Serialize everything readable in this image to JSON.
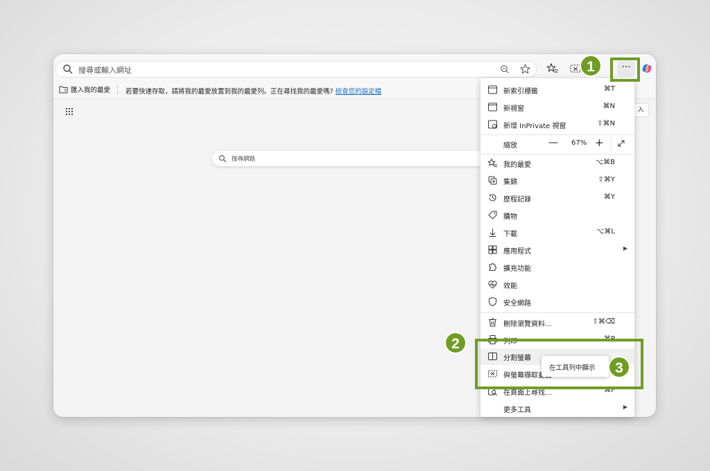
{
  "address_bar": {
    "placeholder": "搜尋或輸入網址"
  },
  "favorites_bar": {
    "import_label": "匯入我的最愛",
    "hint_text": "若要快速存取，請將我的最愛放置到我的最愛列。正在尋找我的最愛嗎?",
    "settings_link": "檢查您的設定檔"
  },
  "new_tab": {
    "search_placeholder": "搜尋網路",
    "signin_label": "入"
  },
  "toolbar": {
    "more_label": "···"
  },
  "menu": {
    "items": [
      {
        "icon": "new-tab-icon",
        "label": "新索引標籤",
        "shortcut": "⌘T"
      },
      {
        "icon": "new-window-icon",
        "label": "新視窗",
        "shortcut": "⌘N"
      },
      {
        "icon": "inprivate-icon",
        "label": "新增 InPrivate 視窗",
        "shortcut": "⇧⌘N"
      },
      {
        "icon": "",
        "label": "縮放",
        "shortcut": ""
      },
      {
        "icon": "favorites-icon",
        "label": "我的最愛",
        "shortcut": "⌥⌘B"
      },
      {
        "icon": "collections-icon",
        "label": "集錦",
        "shortcut": "⇧⌘Y"
      },
      {
        "icon": "history-icon",
        "label": "歷程記錄",
        "shortcut": "⌘Y"
      },
      {
        "icon": "shopping-icon",
        "label": "購物",
        "shortcut": ""
      },
      {
        "icon": "download-icon",
        "label": "下載",
        "shortcut": "⌥⌘L"
      },
      {
        "icon": "apps-icon",
        "label": "應用程式",
        "shortcut": ""
      },
      {
        "icon": "extensions-icon",
        "label": "擴充功能",
        "shortcut": ""
      },
      {
        "icon": "performance-icon",
        "label": "效能",
        "shortcut": ""
      },
      {
        "icon": "shield-icon",
        "label": "安全網路",
        "shortcut": ""
      },
      {
        "icon": "trash-icon",
        "label": "刪除瀏覽資料...",
        "shortcut": "⇧⌘⌫"
      },
      {
        "icon": "print-icon",
        "label": "列印",
        "shortcut": "⌘P"
      },
      {
        "icon": "split-screen-icon",
        "label": "分割螢幕",
        "shortcut": ""
      },
      {
        "icon": "screenshot-icon",
        "label": "與螢幕擷取畫面",
        "shortcut": ""
      },
      {
        "icon": "find-icon",
        "label": "在頁面上尋找...",
        "shortcut": "⌘F"
      },
      {
        "icon": "",
        "label": "更多工具",
        "shortcut": ""
      }
    ],
    "zoom": {
      "minus": "—",
      "value": "67%",
      "plus": "+"
    }
  },
  "tooltip": {
    "label": "在工具列中顯示"
  },
  "badges": {
    "one": "1",
    "two": "2",
    "three": "3"
  },
  "colors": {
    "highlight": "#6f9d23",
    "link": "#1a6fc1"
  }
}
